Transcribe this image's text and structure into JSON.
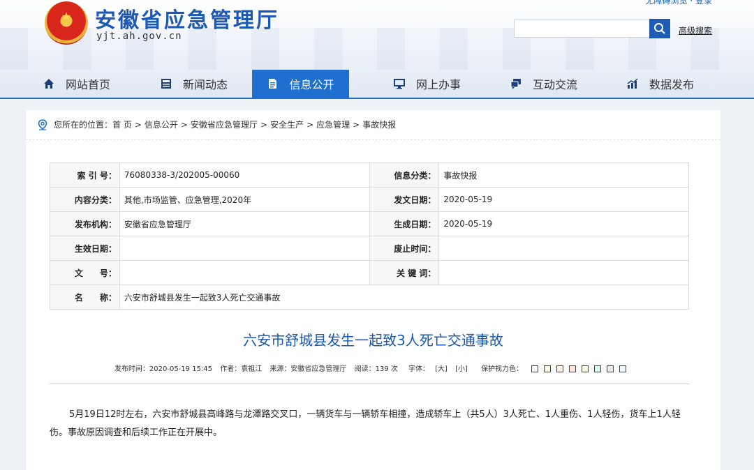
{
  "header": {
    "top_links": "无障碍浏览 · 登录",
    "title": "安徽省应急管理厅",
    "domain": "yjt.ah.gov.cn",
    "search_placeholder": "",
    "advanced_search": "高级搜索"
  },
  "nav": [
    {
      "label": "网站首页",
      "icon": "home-icon"
    },
    {
      "label": "新闻动态",
      "icon": "news-icon"
    },
    {
      "label": "信息公开",
      "icon": "document-icon",
      "active": true
    },
    {
      "label": "网上办事",
      "icon": "monitor-icon"
    },
    {
      "label": "互动交流",
      "icon": "chat-icon"
    },
    {
      "label": "数据发布",
      "icon": "chart-icon"
    }
  ],
  "breadcrumb": {
    "prefix": "您所在的位置：",
    "items": [
      "首 页",
      "信息公开",
      "安徽省应急管理厅",
      "安全生产",
      "应急管理",
      "事故快报"
    ],
    "sep": ">"
  },
  "meta": {
    "index_label": "索 引 号：",
    "index_value": "76080338-3/202005-00060",
    "category_label": "信息分类：",
    "category_value": "事故快报",
    "content_label": "内容分类：",
    "content_value": "其他,市场监管、应急管理,2020年",
    "issue_date_label": "发文日期：",
    "issue_date_value": "2020-05-19",
    "publisher_label": "发布机构：",
    "publisher_value": "安徽省应急管理厅",
    "created_label": "生成日期：",
    "created_value": "2020-05-19",
    "effective_label": "生效日期：",
    "effective_value": "",
    "abolish_label": "废止时间：",
    "abolish_value": "",
    "docno_label": "文　　号：",
    "docno_value": "",
    "keywords_label": "关 键 词：",
    "keywords_value": "",
    "name_label": "名　　称：",
    "name_value": "六安市舒城县发生一起致3人死亡交通事故"
  },
  "article": {
    "title": "六安市舒城县发生一起致3人死亡交通事故",
    "publish_time": "发布时间：2020-05-19 15:45",
    "author": "作者：袁祖江",
    "source": "来源：安徽省应急管理厅",
    "reads": "阅读：139 次",
    "font_label": "字体：",
    "font_large": "[大]",
    "font_small": "[小]",
    "eye_care": "保护视力色：",
    "eye_colors": [
      "#ffffff",
      "#fafbe6",
      "#fff2e2",
      "#fde6e0",
      "#f3ffe1",
      "#dafaef",
      "#eaeaef",
      "#f0f8ff"
    ],
    "body": "5月19日12时左右，六安市舒城县高峰路与龙潭路交叉口，一辆货车与一辆轿车相撞，造成轿车上（共5人）3人死亡、1人重伤、1人轻伤，货车上1人轻伤。事故原因调查和后续工作正在开展中。"
  },
  "colors": {
    "brand": "#1f6fd0",
    "title": "#1a58b0",
    "page_bg": "#eef1f6"
  }
}
